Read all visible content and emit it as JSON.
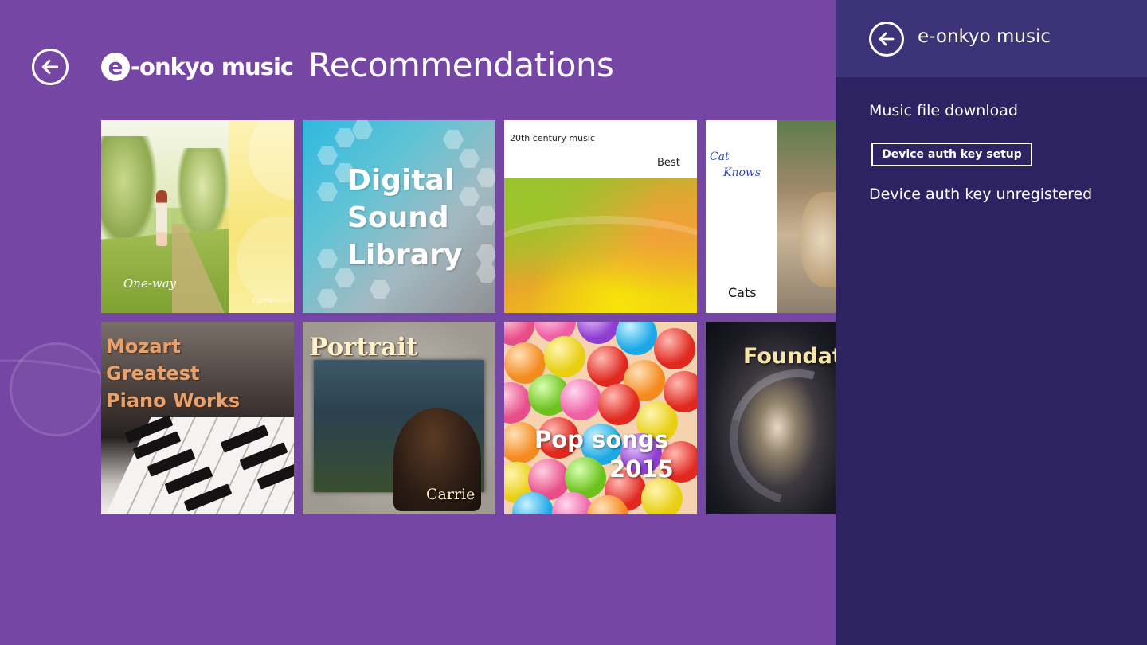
{
  "header": {
    "back_icon": "back-arrow-icon",
    "logo_e": "e",
    "logo_text": "-onkyo music",
    "title": "Recommendations"
  },
  "albums": [
    {
      "title": "One-way",
      "artist": "Carrie"
    },
    {
      "title_lines": [
        "Digital",
        "Sound",
        "Library"
      ]
    },
    {
      "title": "20th century music",
      "subtitle": "Best"
    },
    {
      "title_lines": [
        "Cat",
        "Knows"
      ],
      "subtitle": "Cats"
    },
    {
      "title_lines": [
        "Mozart",
        "Greatest",
        "Piano Works"
      ]
    },
    {
      "title": "Portrait",
      "artist": "Carrie"
    },
    {
      "title": "Pop songs",
      "subtitle": "2015"
    },
    {
      "title": "Foundati"
    }
  ],
  "panel": {
    "back_icon": "back-arrow-icon",
    "title": "e-onkyo music",
    "menu_item": "Music file download",
    "button_label": "Device auth key setup",
    "status": "Device auth key unregistered"
  },
  "colors": {
    "background": "#7546a4",
    "panel_background": "#2d2362",
    "panel_header": "#3d3378"
  }
}
